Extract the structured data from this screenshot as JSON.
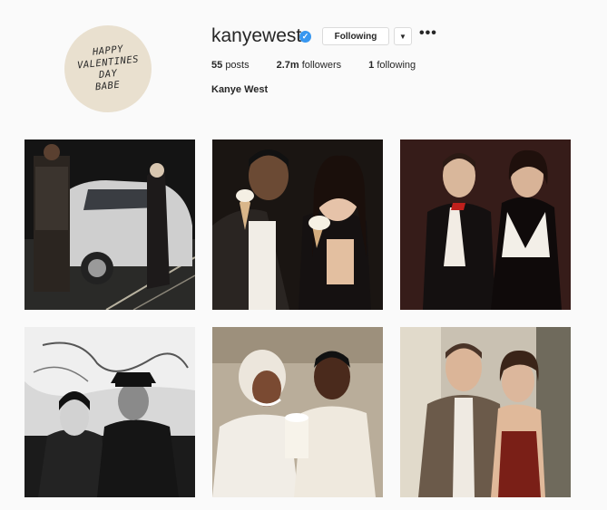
{
  "profile": {
    "avatar_text": [
      "HAPPY",
      "VALENTINES",
      "DAY",
      "BABE"
    ],
    "username": "kanyewest",
    "verified_glyph": "✓",
    "following_label": "Following",
    "dropdown_glyph": "▼",
    "more_glyph": "•••",
    "stats": {
      "posts_count": "55",
      "posts_label": "posts",
      "followers_count": "2.7m",
      "followers_label": "followers",
      "following_count": "1",
      "following_label": "following"
    },
    "full_name": "Kanye West"
  },
  "colors": {
    "background": "#fafafa",
    "verified_blue": "#3897f0",
    "avatar_bg": "#e9e0cf"
  },
  "posts": [
    {
      "id": "post-1",
      "tone": "night-car"
    },
    {
      "id": "post-2",
      "tone": "ice-cream-couple"
    },
    {
      "id": "post-3",
      "tone": "sepia-formal"
    },
    {
      "id": "post-4",
      "tone": "bw-couple"
    },
    {
      "id": "post-5",
      "tone": "wedding-cake"
    },
    {
      "id": "post-6",
      "tone": "suit-and-dress"
    }
  ]
}
